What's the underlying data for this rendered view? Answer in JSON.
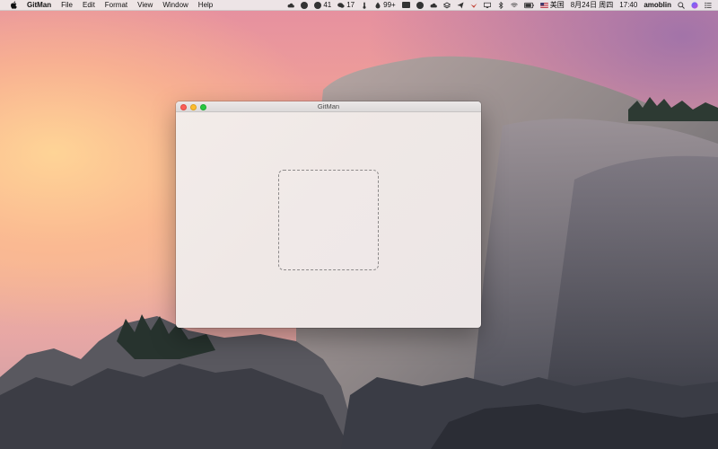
{
  "menubar": {
    "apple_icon": "apple-icon",
    "app_name": "GitMan",
    "menus": [
      "File",
      "Edit",
      "Format",
      "View",
      "Window",
      "Help"
    ],
    "status": {
      "badge_41": "41",
      "badge_17": "17",
      "badge_99": "99+",
      "input_source": "美国",
      "date": "8月24日 周四",
      "time": "17:40",
      "user": "amoblin"
    }
  },
  "window": {
    "title": "GitMan"
  }
}
